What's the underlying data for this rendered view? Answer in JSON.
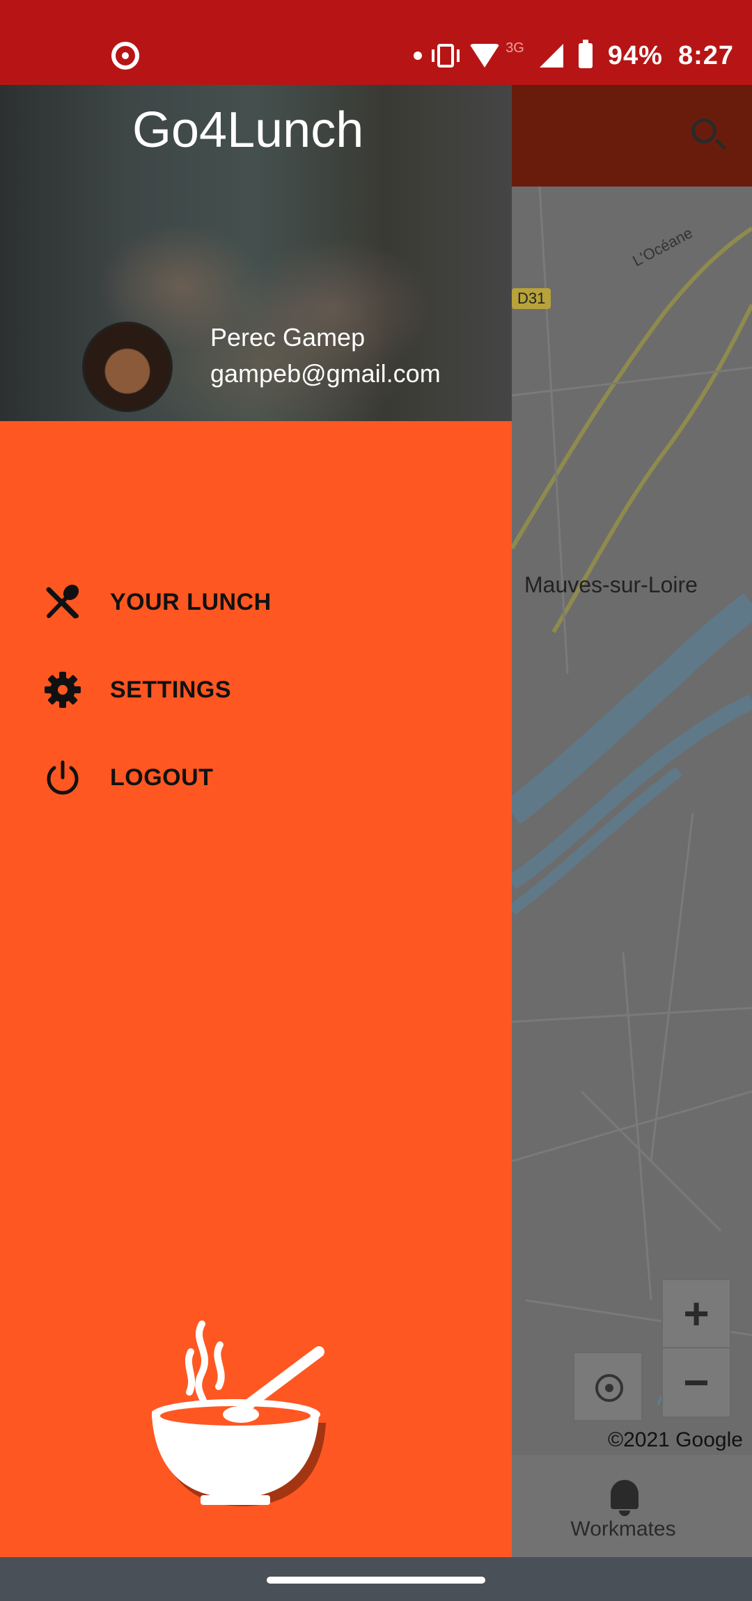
{
  "status_bar": {
    "battery": "94%",
    "time": "8:27",
    "network": "3G",
    "icons": [
      "app-notification-icon",
      "dot-icon",
      "vibrate-icon",
      "wifi-icon",
      "signal-icon",
      "battery-icon"
    ]
  },
  "app": {
    "title": "Go4Lunch",
    "search_icon": "search-icon"
  },
  "user": {
    "name": "Perec Gamep",
    "email": "gampeb@gmail.com"
  },
  "menu": {
    "items": [
      {
        "label": "YOUR LUNCH",
        "icon": "fork-spoon-icon"
      },
      {
        "label": "SETTINGS",
        "icon": "gear-icon"
      },
      {
        "label": "LOGOUT",
        "icon": "power-icon"
      }
    ]
  },
  "map": {
    "road_label": "L'Océane",
    "road_badge": "D31",
    "place_label": "Mauves-sur-Loire",
    "copyright": "©2021 Google",
    "zoom_in": "+",
    "zoom_out": "−"
  },
  "bottom_nav": {
    "workmates_label": "Workmates"
  },
  "colors": {
    "status_bar": "#b71515",
    "drawer": "#ff5722",
    "scrim_map": "#6c6c6c"
  }
}
